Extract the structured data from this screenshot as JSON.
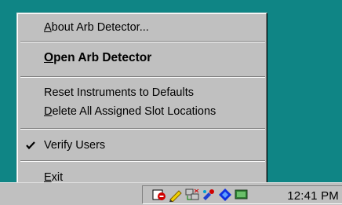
{
  "menu": {
    "items": [
      {
        "pre": "",
        "accel": "A",
        "post": "bout Arb Detector..."
      },
      {
        "pre": "",
        "accel": "O",
        "post": "pen Arb Detector"
      },
      {
        "pre": "Reset Instruments to Defaults",
        "accel": "",
        "post": ""
      },
      {
        "pre": "",
        "accel": "D",
        "post": "elete All Assigned Slot Locations"
      },
      {
        "pre": "Verify Users",
        "accel": "",
        "post": "",
        "checked": true
      },
      {
        "pre": "",
        "accel": "E",
        "post": "xit"
      }
    ]
  },
  "taskbar": {
    "clock": "12:41 PM",
    "tray_icons": [
      "arb-detector-icon",
      "pencil-icon",
      "network-icon",
      "paint-icon",
      "diamond-icon",
      "monitor-icon"
    ]
  },
  "colors": {
    "desktop": "#0f8585",
    "menu_face": "#c0c0c0"
  }
}
